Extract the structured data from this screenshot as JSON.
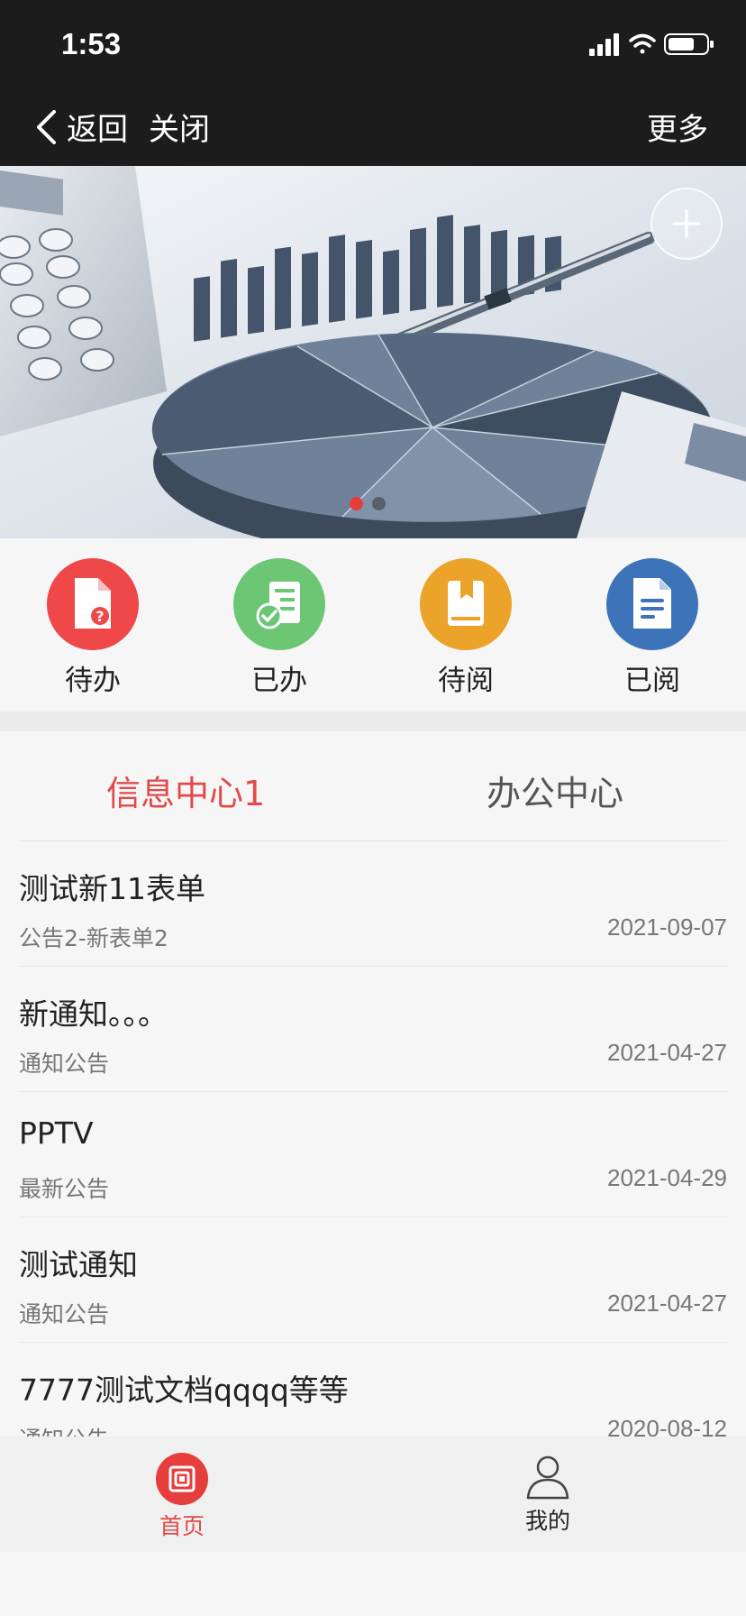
{
  "status_bar": {
    "time": "1:53"
  },
  "nav": {
    "back_label": "返回",
    "close_label": "关闭",
    "more_label": "更多"
  },
  "banner": {
    "slides": 2,
    "active_slide": 1
  },
  "quick_actions": [
    {
      "label": "待办",
      "icon": "document-question-icon",
      "color": "#ef4848"
    },
    {
      "label": "已办",
      "icon": "checklist-icon",
      "color": "#6cc674"
    },
    {
      "label": "待阅",
      "icon": "book-icon",
      "color": "#eba32a"
    },
    {
      "label": "已阅",
      "icon": "document-text-icon",
      "color": "#3d73b8"
    }
  ],
  "tabs": [
    {
      "label": "信息中心1",
      "active": true
    },
    {
      "label": "办公中心",
      "active": false
    }
  ],
  "list": [
    {
      "title": "测试新11表单",
      "category": "公告2-新表单2",
      "date": "2021-09-07"
    },
    {
      "title": "新通知。。。",
      "category": "通知公告",
      "date": "2021-04-27"
    },
    {
      "title": "PPTV",
      "category": "最新公告",
      "date": "2021-04-29"
    },
    {
      "title": "测试通知",
      "category": "通知公告",
      "date": "2021-04-27"
    },
    {
      "title": "7777测试文档qqqq等等",
      "category": "通知公告",
      "date": "2020-08-12"
    }
  ],
  "tabbar": [
    {
      "label": "首页",
      "icon": "home-icon",
      "active": true,
      "color": "#e24a4a"
    },
    {
      "label": "我的",
      "icon": "user-icon",
      "active": false,
      "color": "#222222"
    }
  ],
  "colors": {
    "accent": "#e24a4a",
    "dark_bar": "#1c1c1c"
  }
}
